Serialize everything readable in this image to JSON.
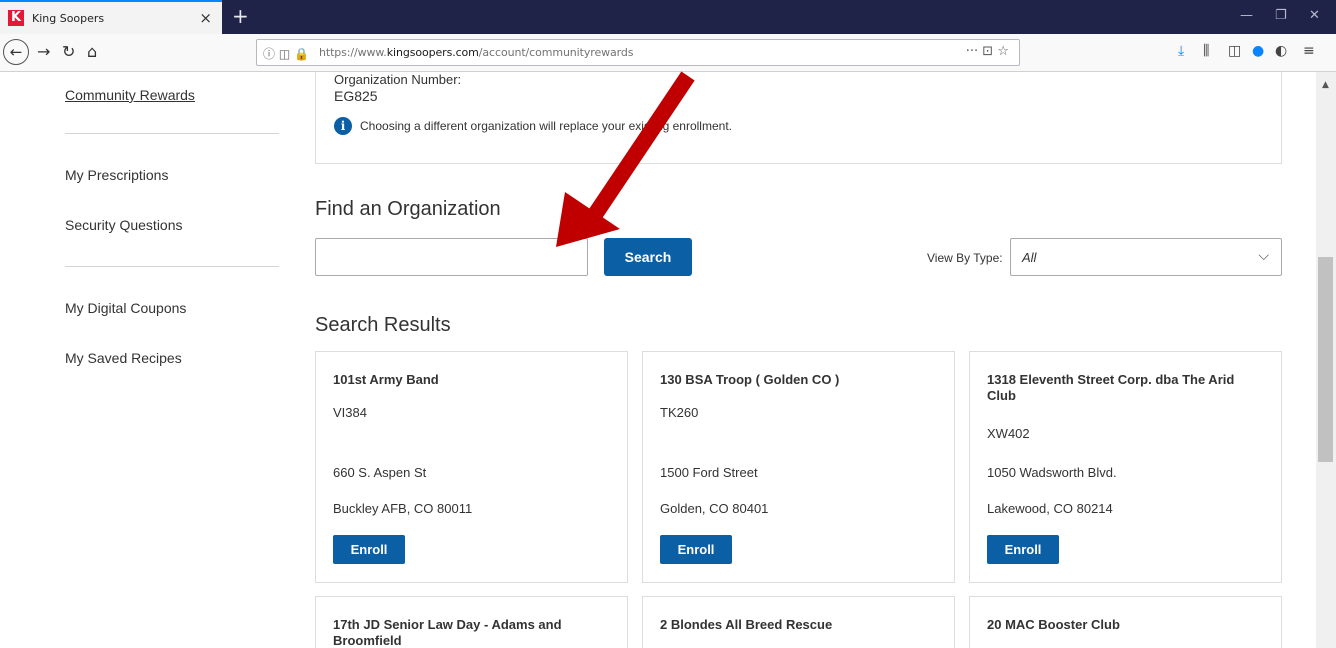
{
  "browser": {
    "tab_title": "King Soopers",
    "tab_favicon_letter": "K",
    "tab_close": "×",
    "new_tab": "+",
    "url_prefix": "https://www.",
    "url_domain": "kingsoopers.com",
    "url_path": "/account/communityrewards",
    "url_actions": "··· ⊡ ☆",
    "window_controls": [
      "—",
      "❐",
      "✕"
    ]
  },
  "sidebar": {
    "active_item": "Community Rewards",
    "group1": [
      "My Prescriptions",
      "Security Questions"
    ],
    "group2": [
      "My Digital Coupons",
      "My Saved Recipes"
    ]
  },
  "current_org": {
    "label": "Organization Number:",
    "number": "EG825",
    "info_text": "Choosing a different organization will replace your existing enrollment."
  },
  "find": {
    "title": "Find an Organization",
    "search_placeholder": "",
    "search_button": "Search",
    "view_by_label": "View By Type:",
    "view_by_value": "All"
  },
  "results": {
    "title": "Search Results",
    "enroll_label": "Enroll",
    "cards": [
      {
        "name": "101st Army Band",
        "code": "VI384",
        "address": "660 S. Aspen St",
        "city": "Buckley AFB, CO 80011"
      },
      {
        "name": "130 BSA Troop ( Golden CO )",
        "code": "TK260",
        "address": "1500 Ford Street",
        "city": "Golden, CO 80401"
      },
      {
        "name": "1318 Eleventh Street Corp. dba The Arid Club",
        "code": "XW402",
        "address": "1050 Wadsworth Blvd.",
        "city": "Lakewood, CO 80214"
      },
      {
        "name": "17th JD Senior Law Day - Adams and Broomfield"
      },
      {
        "name": "2 Blondes All Breed Rescue"
      },
      {
        "name": "20 MAC Booster Club"
      }
    ]
  },
  "colors": {
    "brand_blue": "#0b5fa5",
    "arrow_red": "#c00000",
    "tabbar_bg": "#1f2347"
  }
}
